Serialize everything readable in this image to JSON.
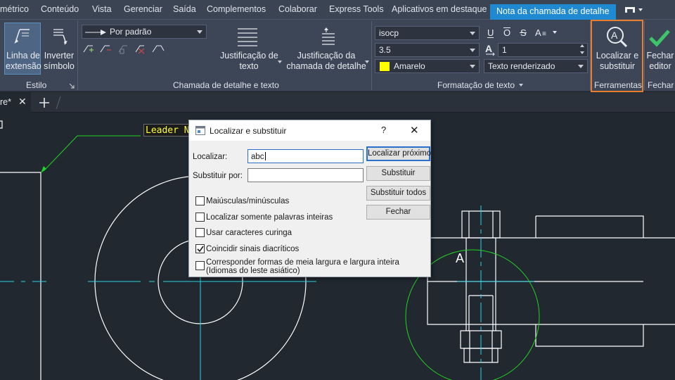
{
  "ribbon_tabs": [
    "métrico",
    "Conteúdo",
    "Vista",
    "Gerenciar",
    "Saída",
    "Complementos",
    "Colaborar",
    "Express Tools",
    "Aplicativos em destaque",
    "Nota da chamada de detalhe"
  ],
  "ribbon": {
    "estilo": {
      "title": "Estilo",
      "linha_line1": "Linha de",
      "linha_line2": "extensão",
      "inverter_line1": "Inverter",
      "inverter_line2": "símbolo"
    },
    "chamada": {
      "title": "Chamada de detalhe e texto",
      "style_combo": "Por padrão",
      "just_texto_line1": "Justificação de",
      "just_texto_line2": "texto",
      "just_chamada_line1": "Justificação da",
      "just_chamada_line2": "chamada de detalhe"
    },
    "formatacao": {
      "title": "Formatação de texto",
      "font": "isocp",
      "height": "3.5",
      "color": "Amarelo",
      "color_hex": "#ffff00",
      "spacing": "1",
      "render": "Texto renderizado"
    },
    "ferramentas": {
      "title": "Ferramentas",
      "find_line1": "Localizar e",
      "find_line2": "substituir"
    },
    "fechar": {
      "title": "Fechar",
      "close_line1": "Fechar",
      "close_line2": "editor"
    }
  },
  "doc_tab": {
    "label": "re*"
  },
  "canvas": {
    "leader_text": "Leader Na",
    "label_a": "A"
  },
  "dialog": {
    "title": "Localizar e substituir",
    "help": "?",
    "find_label": "Localizar:",
    "find_value": "abc",
    "replace_label": "Substituir por:",
    "replace_value": "",
    "buttons": {
      "find_next": "Localizar próximo",
      "replace": "Substituir",
      "replace_all": "Substituir todos",
      "close": "Fechar"
    },
    "options": [
      {
        "label": "Maiúsculas/minúsculas",
        "checked": false
      },
      {
        "label": "Localizar somente palavras inteiras",
        "checked": false
      },
      {
        "label": "Usar caracteres curinga",
        "checked": false
      },
      {
        "label": "Coincidir sinais diacríticos",
        "checked": true
      },
      {
        "label": "Corresponder formas de meia largura e largura inteira",
        "label2": "(Idiomas do leste asiático)",
        "checked": false
      }
    ]
  }
}
